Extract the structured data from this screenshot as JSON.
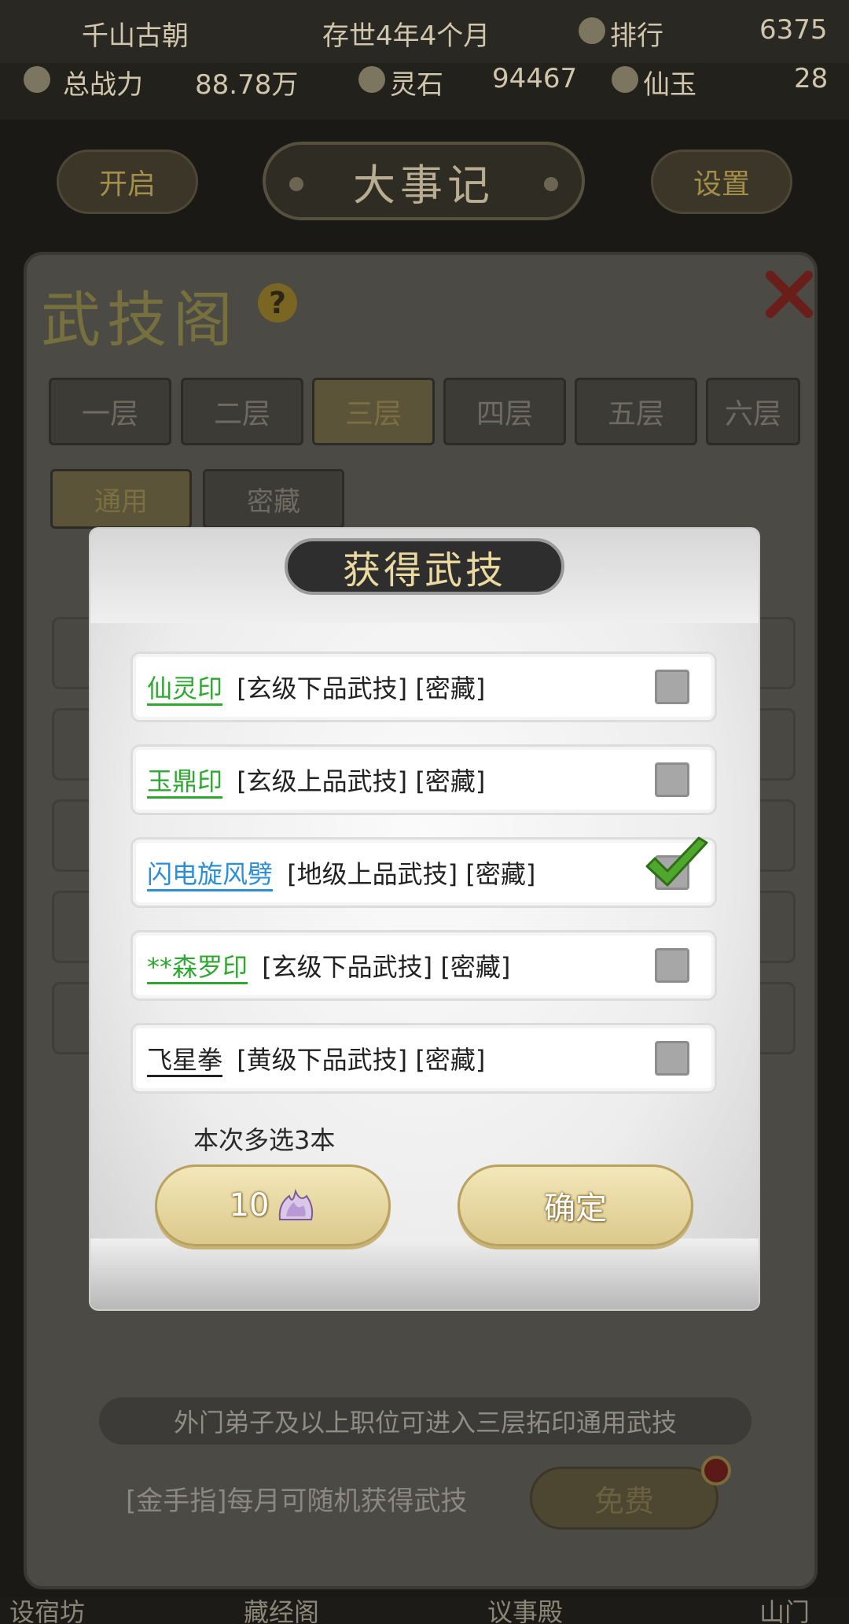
{
  "topbar": {
    "sect_name": "千山古朝",
    "existence": "存世4年4个月",
    "rank_label": "排行",
    "rank_value": "6375",
    "power_label": "总战力",
    "power_value": "88.78万",
    "spirit_stone_label": "灵石",
    "spirit_stone_value": "94467",
    "jade_label": "仙玉",
    "jade_value": "28"
  },
  "header": {
    "title": "大事记",
    "left_button": "开启",
    "right_button": "设置"
  },
  "panel": {
    "title": "武技阁",
    "help": "?",
    "floors": [
      "一层",
      "二层",
      "三层",
      "四层",
      "五层",
      "六层"
    ],
    "subtabs": [
      "通用",
      "密藏"
    ],
    "notice": "外门弟子及以上职位可进入三层拓印通用武技",
    "footer_text": "[金手指]每月可随机获得武技",
    "free_button": "免费"
  },
  "bottom_nav": [
    "设宿坊",
    "藏经阁",
    "议事殿",
    "山门"
  ],
  "modal": {
    "title": "获得武技",
    "items": [
      {
        "name": "仙灵印",
        "desc": " [玄级下品武技] [密藏]",
        "name_color": "#2fa832",
        "checked": false
      },
      {
        "name": "玉鼎印",
        "desc": " [玄级上品武技] [密藏]",
        "name_color": "#2fa832",
        "checked": false
      },
      {
        "name": "闪电旋风劈",
        "desc": " [地级上品武技] [密藏]",
        "name_color": "#2b8ed8",
        "checked": true
      },
      {
        "name": "**森罗印",
        "desc": " [玄级下品武技] [密藏]",
        "name_color": "#2fa832",
        "checked": false
      },
      {
        "name": "飞星拳",
        "desc": " [黄级下品武技] [密藏]",
        "name_color": "#222222",
        "checked": false
      }
    ],
    "hint": "本次多选3本",
    "cost_value": "10",
    "cost_icon": "spirit-crystal-icon",
    "confirm_label": "确定"
  }
}
